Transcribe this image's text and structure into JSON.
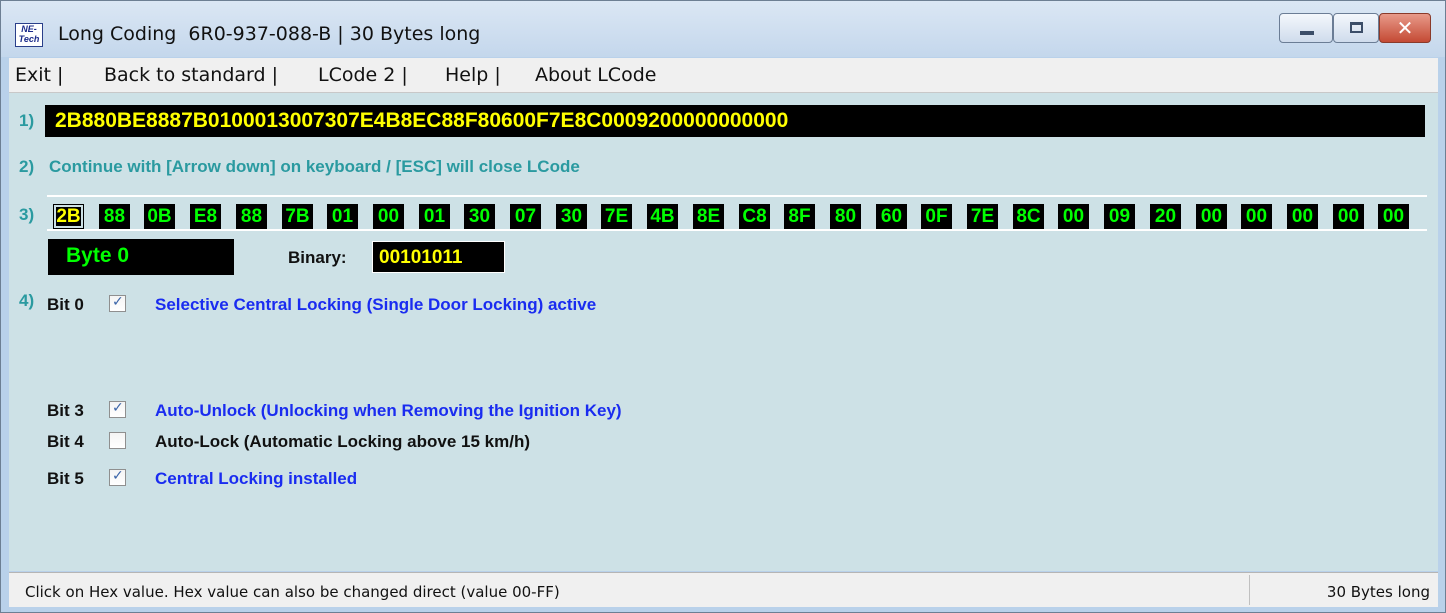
{
  "window": {
    "title": "Long Coding  6R0-937-088-B | 30 Bytes long",
    "app_icon_text": "NE-Tech"
  },
  "menu": [
    {
      "label": "Exit |"
    },
    {
      "label": "Back to standard |"
    },
    {
      "label": "LCode 2 |"
    },
    {
      "label": "Help |"
    },
    {
      "label": "About LCode"
    }
  ],
  "steps": {
    "s1": "1)",
    "s2": "2)",
    "s3": "3)",
    "s4": "4)"
  },
  "coding_string": "2B880BE8887B0100013007307E4B8EC88F80600F7E8C0009200000000000",
  "instruction": "Continue with [Arrow down] on keyboard / [ESC] will close LCode",
  "bytes": [
    "2B",
    "88",
    "0B",
    "E8",
    "88",
    "7B",
    "01",
    "00",
    "01",
    "30",
    "07",
    "30",
    "7E",
    "4B",
    "8E",
    "C8",
    "8F",
    "80",
    "60",
    "0F",
    "7E",
    "8C",
    "00",
    "09",
    "20",
    "00",
    "00",
    "00",
    "00",
    "00"
  ],
  "selected_byte": {
    "label": "Byte 0",
    "binary_label": "Binary:",
    "binary_value": "00101011"
  },
  "bits": [
    {
      "bit": "Bit 0",
      "checked": true,
      "description": "Selective Central Locking (Single Door Locking) active",
      "color": "#1a2cf0"
    },
    {
      "bit": "Bit 3",
      "checked": true,
      "description": "Auto-Unlock (Unlocking when Removing the Ignition Key)",
      "color": "#1a2cf0"
    },
    {
      "bit": "Bit 4",
      "checked": false,
      "description": "Auto-Lock (Automatic Locking above 15 km/h)",
      "color": "#111111"
    },
    {
      "bit": "Bit 5",
      "checked": true,
      "description": "Central Locking installed",
      "color": "#1a2cf0"
    }
  ],
  "status": {
    "left": "Click on Hex value. Hex value can also be changed direct (value 00-FF)",
    "right": "30 Bytes long"
  },
  "colors": {
    "hex_fg": "#00ff00",
    "coding_fg": "#ffff00",
    "accent": "#2a9aa0",
    "bit_on": "#1a2cf0"
  }
}
